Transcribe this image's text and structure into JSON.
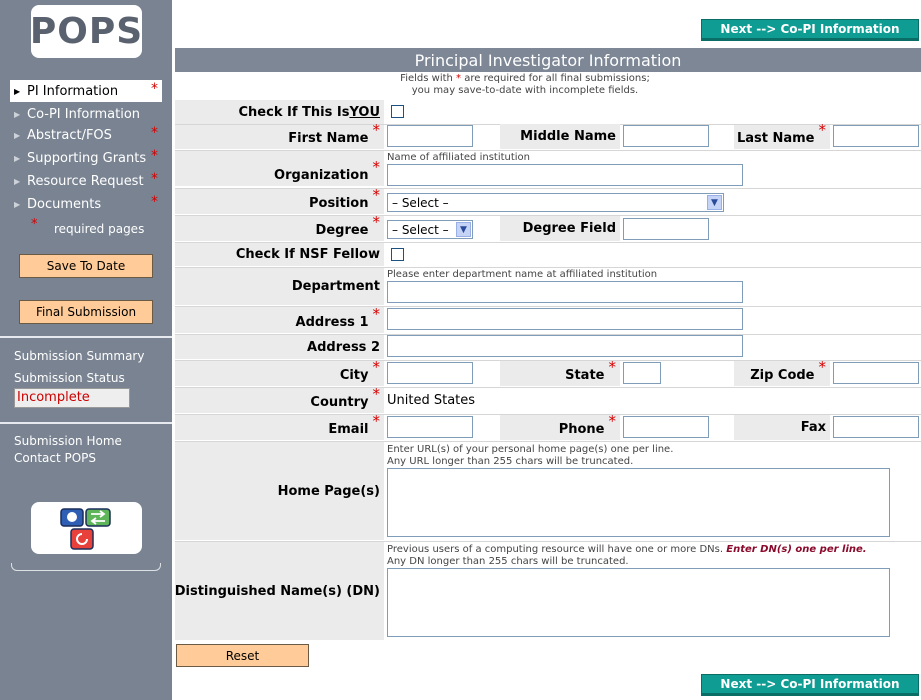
{
  "sidebar": {
    "logo_text": "POPS",
    "nav": [
      {
        "label": "PI Information",
        "required": true,
        "active": true
      },
      {
        "label": "Co-PI Information",
        "required": false
      },
      {
        "label": "Abstract/FOS",
        "required": true
      },
      {
        "label": "Supporting Grants",
        "required": true
      },
      {
        "label": "Resource Request",
        "required": true
      },
      {
        "label": "Documents",
        "required": true
      }
    ],
    "required_star": "*",
    "required_note": "required pages",
    "save_button": "Save To Date",
    "final_button": "Final Submission",
    "submission_summary": "Submission Summary",
    "submission_status": "Submission Status",
    "status_value": "Incomplete",
    "submission_home": "Submission Home",
    "contact": "Contact POPS"
  },
  "main": {
    "next_button": "Next --> Co-PI Information",
    "title": "Principal Investigator Information",
    "note_line1_a": "Fields with",
    "note_star": "*",
    "note_line1_b": "are required for all final submissions;",
    "note_line2": "you may save-to-date with incomplete fields.",
    "labels": {
      "check_you_prefix": "Check If This Is ",
      "check_you_emph": "YOU",
      "first_name": "First Name",
      "middle_name": "Middle Name",
      "last_name": "Last Name",
      "organization": "Organization",
      "position": "Position",
      "degree": "Degree",
      "degree_field": "Degree Field",
      "nsf_fellow": "Check If NSF Fellow",
      "department": "Department",
      "address1": "Address 1",
      "address2": "Address 2",
      "city": "City",
      "state": "State",
      "zip": "Zip Code",
      "country": "Country",
      "email": "Email",
      "phone": "Phone",
      "fax": "Fax",
      "home_pages": "Home Page(s)",
      "dn": "Distinguished Name(s) (DN)"
    },
    "req_star": "*",
    "hints": {
      "organization": "Name of affiliated institution",
      "department": "Please enter department name at affiliated institution",
      "home1": "Enter URL(s) of your personal home page(s) one per line.",
      "home2": "Any URL longer than 255 chars will be truncated.",
      "dn1": "Previous users of a computing resource will have one or more DNs.",
      "dn1_emph": "Enter DN(s) one per line.",
      "dn2": "Any DN longer than 255 chars will be truncated."
    },
    "position_value": "– Select –",
    "degree_value": "– Select –",
    "country_value": "United States",
    "reset_button": "Reset"
  }
}
